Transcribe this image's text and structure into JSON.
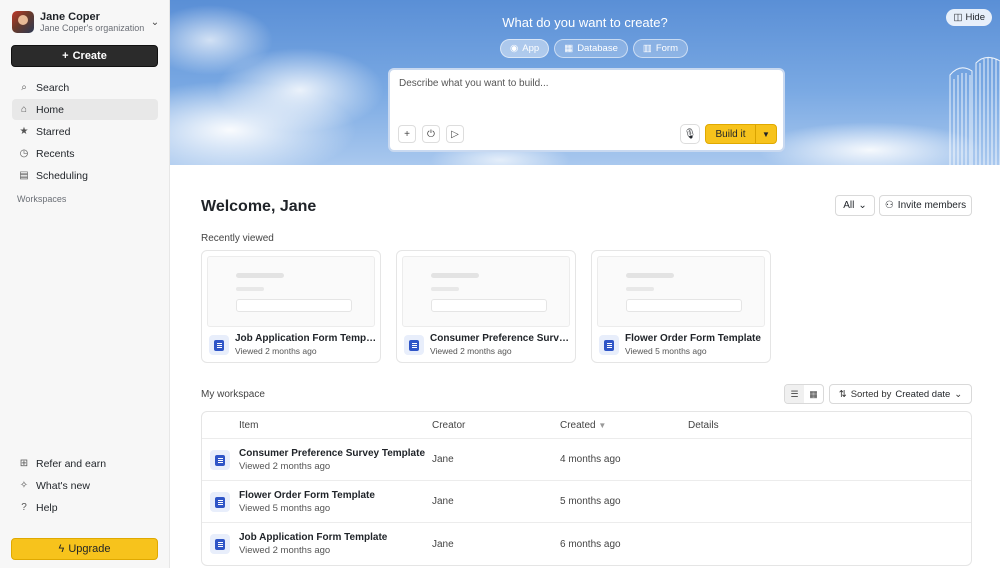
{
  "sidebar": {
    "account_name": "Jane Coper",
    "account_org": "Jane Coper's organization",
    "create_label": "Create",
    "nav": [
      {
        "label": "Search",
        "icon": "search-icon"
      },
      {
        "label": "Home",
        "icon": "home-icon",
        "active": true
      },
      {
        "label": "Starred",
        "icon": "star-icon"
      },
      {
        "label": "Recents",
        "icon": "clock-icon"
      },
      {
        "label": "Scheduling",
        "icon": "calendar-icon"
      }
    ],
    "workspaces_label": "Workspaces",
    "bottom_nav": [
      {
        "label": "Refer and earn",
        "icon": "gift-icon"
      },
      {
        "label": "What's new",
        "icon": "sparkle-icon"
      },
      {
        "label": "Help",
        "icon": "help-icon"
      }
    ],
    "upgrade_label": "Upgrade"
  },
  "hero": {
    "title": "What do you want to create?",
    "tabs": [
      {
        "label": "App",
        "active": true
      },
      {
        "label": "Database"
      },
      {
        "label": "Form"
      }
    ],
    "hide_label": "Hide",
    "prompt_placeholder": "Describe what you want to build...",
    "build_label": "Build it"
  },
  "main": {
    "welcome": "Welcome, Jane",
    "filter_label": "All",
    "invite_label": "Invite members",
    "recently_viewed_label": "Recently viewed",
    "recent": [
      {
        "title": "Job Application Form Template",
        "sub": "Viewed 2 months ago"
      },
      {
        "title": "Consumer Preference Survey ...",
        "sub": "Viewed 2 months ago"
      },
      {
        "title": "Flower Order Form Template",
        "sub": "Viewed 5 months ago"
      }
    ],
    "workspace_label": "My workspace",
    "sort_prefix": "Sorted by",
    "sort_value": "Created date",
    "columns": {
      "item": "Item",
      "creator": "Creator",
      "created": "Created",
      "details": "Details"
    },
    "rows": [
      {
        "title": "Consumer Preference Survey Template",
        "sub": "Viewed 2 months ago",
        "creator": "Jane",
        "created": "4 months ago",
        "details": ""
      },
      {
        "title": "Flower Order Form Template",
        "sub": "Viewed 5 months ago",
        "creator": "Jane",
        "created": "5 months ago",
        "details": ""
      },
      {
        "title": "Job Application Form Template",
        "sub": "Viewed 2 months ago",
        "creator": "Jane",
        "created": "6 months ago",
        "details": ""
      }
    ]
  },
  "colors": {
    "accent": "#f7c31c",
    "dark_button": "#2b2b2b",
    "form_icon": "#2f55c7"
  }
}
